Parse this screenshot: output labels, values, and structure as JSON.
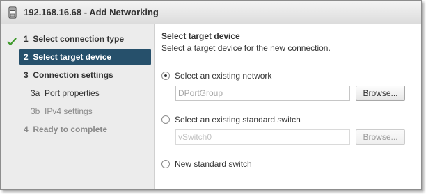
{
  "window": {
    "title": "192.168.16.68 - Add Networking",
    "icon": "host-server-icon"
  },
  "steps": [
    {
      "num": "1",
      "label": "Select connection type",
      "state": "done"
    },
    {
      "num": "2",
      "label": "Select target device",
      "state": "current"
    },
    {
      "num": "3",
      "label": "Connection settings",
      "state": "pending"
    },
    {
      "num": "3a",
      "label": "Port properties",
      "state": "pending-sub"
    },
    {
      "num": "3b",
      "label": "IPv4 settings",
      "state": "disabled-sub"
    },
    {
      "num": "4",
      "label": "Ready to complete",
      "state": "disabled"
    }
  ],
  "page": {
    "title": "Select target device",
    "subtitle": "Select a target device for the new connection."
  },
  "options": {
    "existing_network": {
      "label": "Select an existing network",
      "selected": true,
      "field_value": "DPortGroup",
      "browse_label": "Browse..."
    },
    "existing_switch": {
      "label": "Select an existing standard switch",
      "selected": false,
      "field_value": "vSwitch0",
      "browse_label": "Browse..."
    },
    "new_switch": {
      "label": "New standard switch",
      "selected": false
    }
  },
  "colors": {
    "current_step_bg": "#26506b",
    "check_green": "#3f9a2c"
  }
}
